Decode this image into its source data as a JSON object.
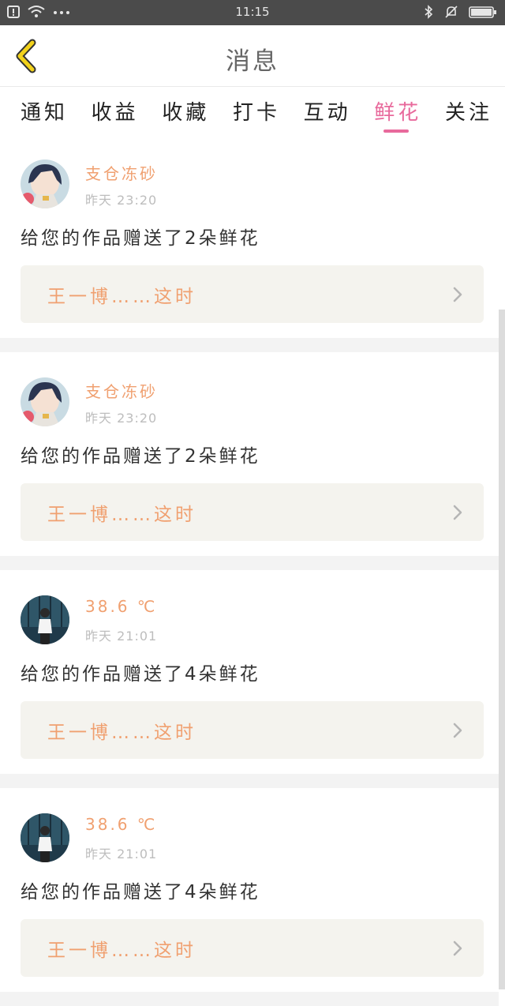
{
  "status_bar": {
    "time": "11:15",
    "left_icons": [
      "sim-alert-icon",
      "wifi-icon",
      "more-dots-icon"
    ],
    "right_icons": [
      "bluetooth-icon",
      "silent-bell-icon",
      "battery-icon"
    ]
  },
  "header": {
    "title": "消息",
    "back_icon": "back-chevron-icon"
  },
  "tabs": [
    {
      "label": "通知",
      "active": false
    },
    {
      "label": "收益",
      "active": false
    },
    {
      "label": "收藏",
      "active": false
    },
    {
      "label": "打卡",
      "active": false
    },
    {
      "label": "互动",
      "active": false
    },
    {
      "label": "鲜花",
      "active": true
    },
    {
      "label": "关注",
      "active": false
    }
  ],
  "messages": [
    {
      "avatar": "anime-girl-avatar",
      "name": "支仓冻砂",
      "time": "昨天 23:20",
      "text": "给您的作品赠送了2朵鲜花",
      "work_title": "王一博……这时"
    },
    {
      "avatar": "anime-girl-avatar",
      "name": "支仓冻砂",
      "time": "昨天 23:20",
      "text": "给您的作品赠送了2朵鲜花",
      "work_title": "王一博……这时"
    },
    {
      "avatar": "person-photo-avatar",
      "name": "38.6 ℃",
      "time": "昨天 21:01",
      "text": "给您的作品赠送了4朵鲜花",
      "work_title": "王一博……这时"
    },
    {
      "avatar": "person-photo-avatar",
      "name": "38.6 ℃",
      "time": "昨天 21:01",
      "text": "给您的作品赠送了4朵鲜花",
      "work_title": "王一博……这时"
    }
  ],
  "colors": {
    "accent": "#e86a9c",
    "name_orange": "#f0a070",
    "back_yellow": "#f2d21b"
  }
}
